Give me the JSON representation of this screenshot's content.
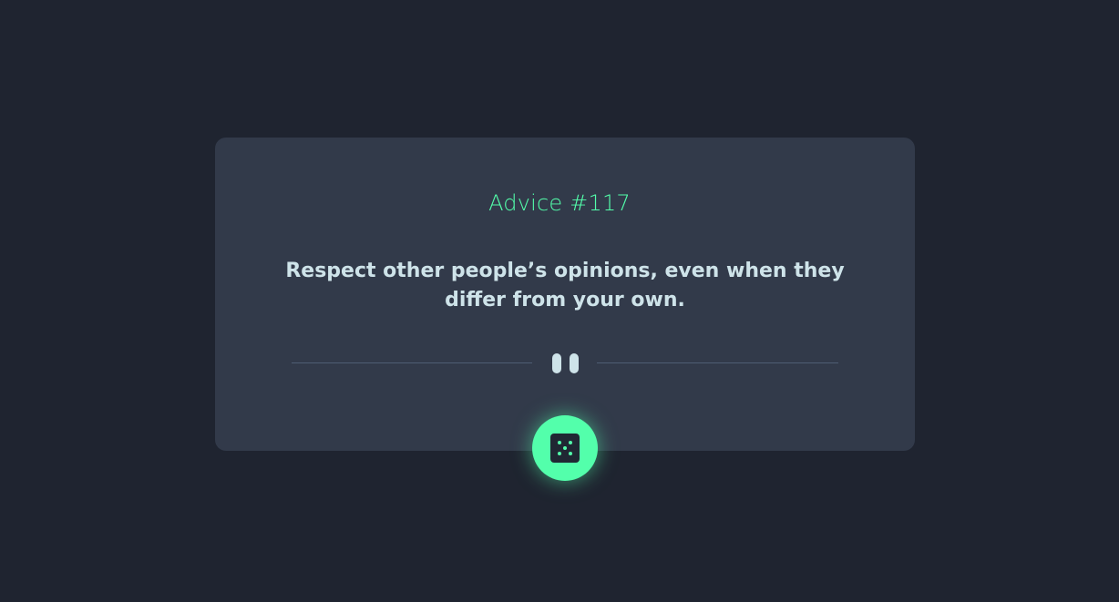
{
  "advice": {
    "id_label": "Advice #117",
    "text": "Respect other people’s opinions, even when they differ from your own."
  },
  "divider": {
    "icon": "pause-icon"
  },
  "actions": {
    "generate_icon": "dice-icon"
  },
  "colors": {
    "background": "#1f2430",
    "card": "#323a4a",
    "accent": "#53ffab",
    "text": "#cee3e9",
    "divider": "#4f5d74"
  }
}
